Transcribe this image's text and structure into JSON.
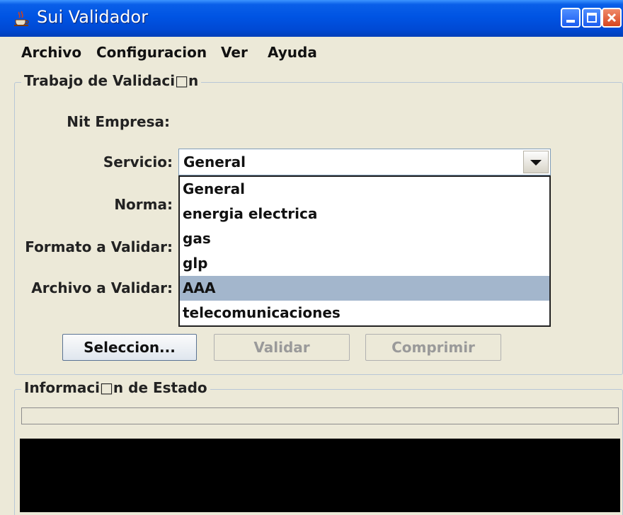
{
  "window": {
    "title": "Sui Validador"
  },
  "menu": {
    "items": [
      "Archivo",
      "Configuracion",
      "Ver",
      "Ayuda"
    ]
  },
  "trabajo": {
    "title": "Trabajo de Validaci□n",
    "labels": {
      "nit": "Nit Empresa:",
      "servicio": "Servicio:",
      "norma": "Norma:",
      "formato": "Formato a Validar:",
      "archivo": "Archivo a Validar:"
    },
    "servicio_value": "General",
    "servicio_options": [
      "General",
      "energia electrica",
      "gas",
      "glp",
      "AAA",
      "telecomunicaciones"
    ],
    "servicio_highlighted": "AAA",
    "buttons": {
      "seleccion": "Seleccion...",
      "validar": "Validar",
      "comprimir": "Comprimir"
    }
  },
  "estado": {
    "title": "Informaci□n de Estado",
    "progress": 0
  },
  "icons": {
    "app": "java-cup-icon",
    "minimize": "minimize-icon",
    "maximize": "maximize-icon",
    "close": "close-icon",
    "dropdown": "chevron-down-icon"
  },
  "colors": {
    "titlebar": "#0054e3",
    "selection": "#a3b6cc",
    "console": "#000000"
  }
}
